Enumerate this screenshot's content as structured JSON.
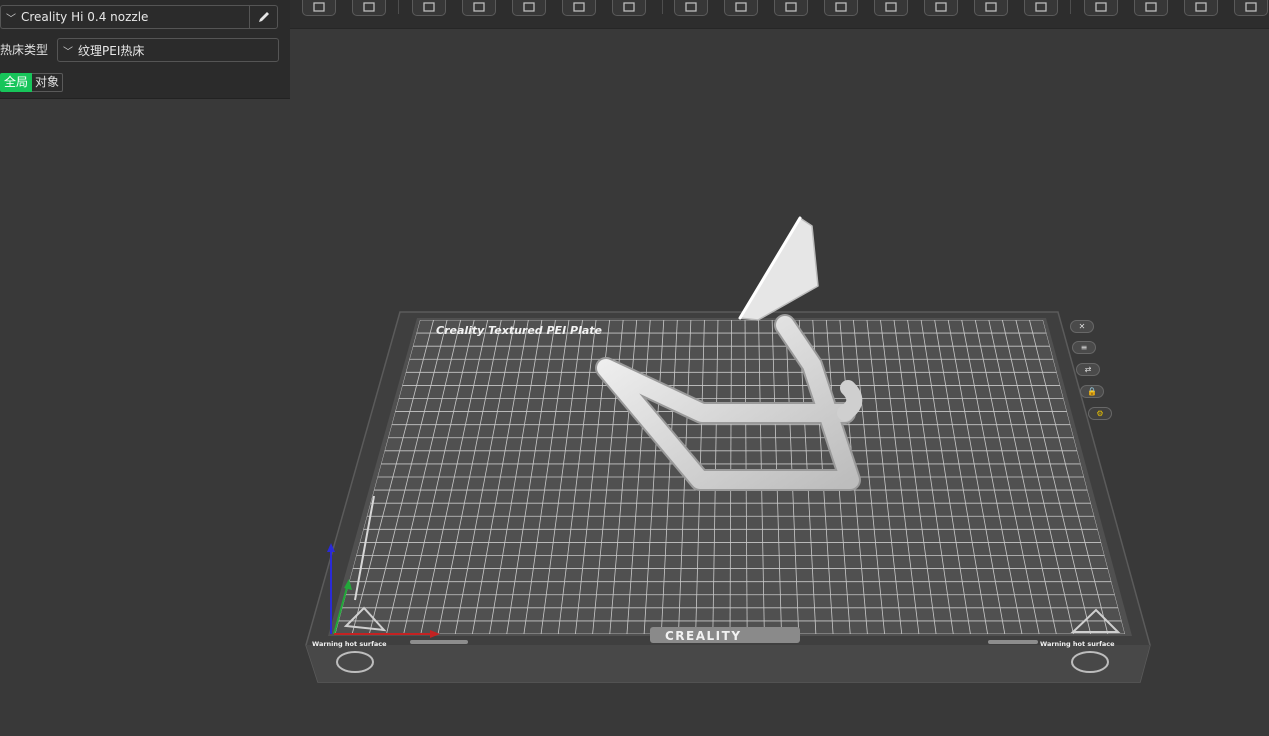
{
  "panel": {
    "printer_name": "Creality Hi 0.4 nozzle",
    "bed_type_label": "热床类型",
    "bed_type_value": "纹理PEI热床",
    "toggle_global": "全局",
    "toggle_object": "对象"
  },
  "plate": {
    "title": "Creality Textured PEI Plate",
    "brand": "CREALITY",
    "warning_left": "Warning hot surface",
    "warning_right": "Warning hot surface"
  },
  "toolbar": {
    "icons": [
      "add-object-icon",
      "arrange-grid-icon",
      "orient-icon",
      "lay-on-face-icon",
      "paint-support-icon",
      "auto-arrange-icon",
      "slice-plate-icon",
      "split-objects-icon",
      "cut-icon",
      "measure-icon",
      "assembly-icon",
      "hollow-icon",
      "seam-paint-icon",
      "text-emboss-icon",
      "boolean-icon",
      "support-paint-icon",
      "fdm-supports-icon",
      "layer-icon",
      "view-settings-icon"
    ]
  },
  "colors": {
    "accent": "#17c55a",
    "background": "#393939",
    "panel": "#2b2b2b"
  }
}
